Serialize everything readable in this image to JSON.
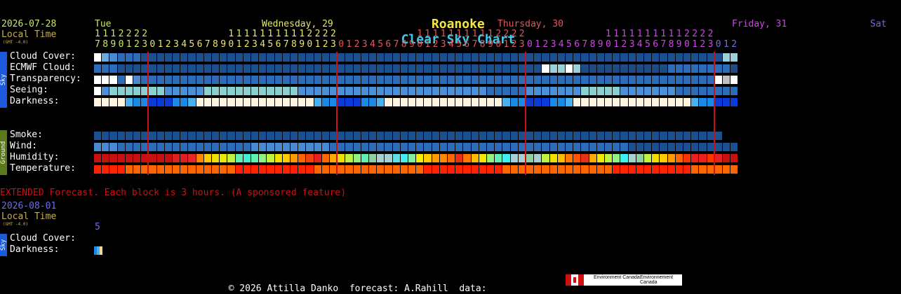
{
  "page": {
    "title_location": "Roanoke",
    "title_rest": "Clear Sky Chart"
  },
  "date": {
    "start": "2026-07-28",
    "local_time": "Local Time",
    "gmt": "(GMT -4.0)"
  },
  "days": [
    {
      "label": "Tue",
      "hours_top": "1 1 1 2 2 2 2",
      "hours_bottom": "7 8 9 0 1 2 3",
      "color": "#c8e86a"
    },
    {
      "label": "Wednesday, 29",
      "hours_top": "1 1 1 1 1 1 1 1 1 1 1 2 2 2 2",
      "hours_bottom": "0 1 2 3 4 5 6 7 8 9 0 1 2 3 4 5 6 7 8 9 0 1 2 3",
      "color": "#e8e86a"
    },
    {
      "label": "Thursday, 30",
      "hours_top": "1 1 1 1 1 1 1 1 1 1 1 2 2 2 2",
      "hours_bottom": "0 1 2 3 4 5 6 7 8 9 0 1 2 3 4 5 6 7 8 9 0 1 2 3",
      "color": "#e8555a"
    },
    {
      "label": "Friday, 31",
      "hours_top": "1 1 1 1 1 1 1 1 1 1 1 2 2 2 2",
      "hours_bottom": "0 1 2 3 4 5 6 7 8 9 0 1 2 3 4 5 6 7 8 9 0 1 2 3",
      "color": "#c84ae0"
    },
    {
      "label": "Sat",
      "hours_top": "",
      "hours_bottom": "0 1 2",
      "color": "#6e6ee8"
    }
  ],
  "sections": {
    "sky": "Sky",
    "ground": "Ground"
  },
  "rows": {
    "cloud_cover": "Cloud Cover:",
    "ecmwf_cloud": "ECMWF Cloud:",
    "transparency": "Transparency:",
    "seeing": "Seeing:",
    "darkness": "Darkness:",
    "smoke": "Smoke:",
    "wind": "Wind:",
    "humidity": "Humidity:",
    "temperature": "Temperature:"
  },
  "extended": {
    "notice": "EXTENDED Forecast. Each block is 3 hours. (A sponsored feature)",
    "date": "2026-08-01",
    "local_time": "Local Time",
    "gmt": "(GMT -4.0)",
    "hour": "5",
    "cloud_cover": "Cloud Cover:",
    "darkness": "Darkness:",
    "sky": "Sky"
  },
  "footer": {
    "copyright": "© 2026 Attilla Danko",
    "forecast": "forecast: A.Rahill",
    "data": "data:",
    "logo_text_1": "Environment Canada",
    "logo_text_2": "Environnement Canada"
  },
  "colors": {
    "title_location": "#f4e83a",
    "title_rest": "#3ec8e8",
    "date": "#c8e86a",
    "local_time": "#c8b04a",
    "extended": "#cc1111",
    "ext_date": "#6e6ee8",
    "marker": "#cc1111"
  }
}
